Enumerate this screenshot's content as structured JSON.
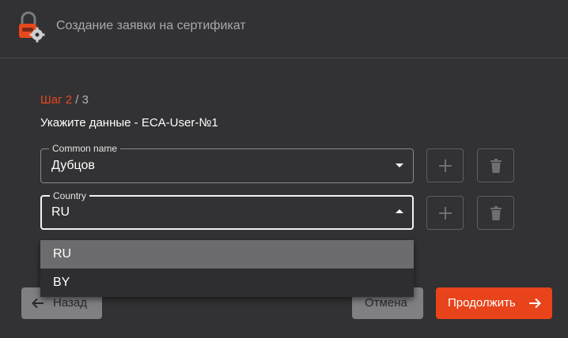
{
  "header": {
    "title": "Создание заявки на сертификат",
    "logo_icon": "lock-gear-logo-icon"
  },
  "step": {
    "prefix": "Шаг",
    "current": "2",
    "separator": "/",
    "total": "3"
  },
  "heading": "Укажите данные - ECA-User-№1",
  "fields": [
    {
      "legend": "Common name",
      "value": "Дубцов",
      "expanded": false
    },
    {
      "legend": "Country",
      "value": "RU",
      "expanded": true
    }
  ],
  "dropdown": {
    "options": [
      "RU",
      "BY"
    ],
    "selected": "RU"
  },
  "buttons": {
    "back": "Назад",
    "cancel": "Отмена",
    "continue": "Продолжить"
  },
  "colors": {
    "accent": "#e8431a",
    "background": "#323133",
    "selected_option": "#6c6c6e"
  }
}
